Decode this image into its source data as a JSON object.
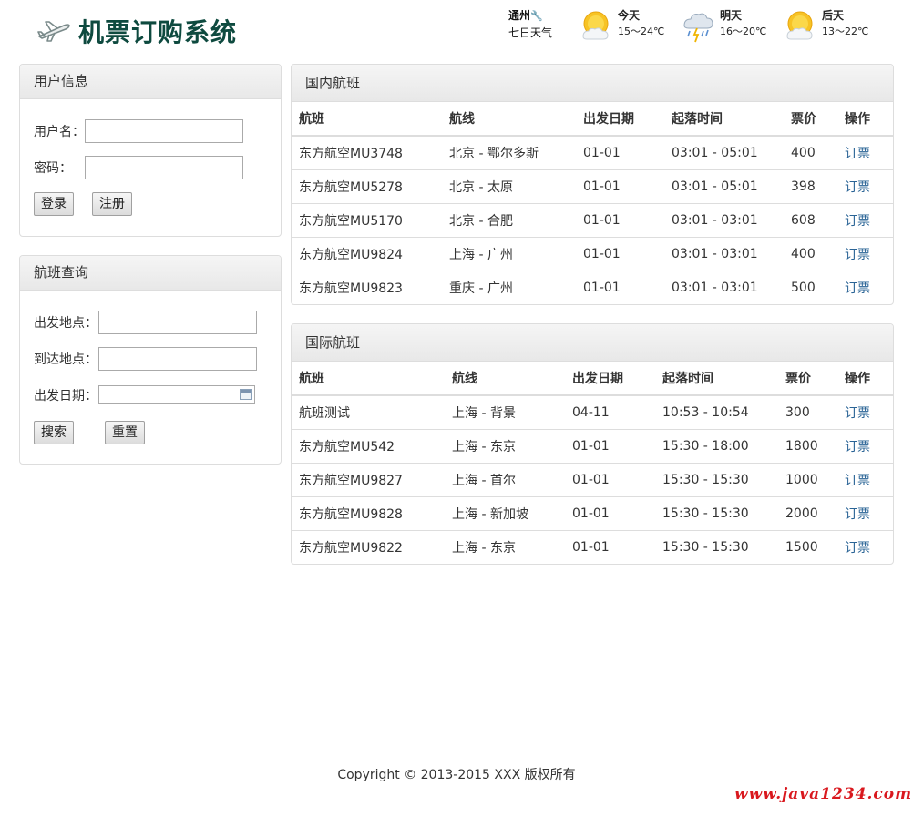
{
  "header": {
    "title": "机票订购系统",
    "weather": {
      "city": "通州",
      "subtitle": "七日天气",
      "days": [
        {
          "name": "今天",
          "range": "15～24℃",
          "icon": "sunny-cloudy-icon"
        },
        {
          "name": "明天",
          "range": "16～20℃",
          "icon": "thunderstorm-icon"
        },
        {
          "name": "后天",
          "range": "13～22℃",
          "icon": "sunny-cloudy-icon"
        }
      ]
    }
  },
  "user_panel": {
    "title": "用户信息",
    "username_label": "用户名：",
    "username_value": "",
    "password_label": "密码：",
    "password_value": "",
    "login_label": "登录",
    "register_label": "注册"
  },
  "search_panel": {
    "title": "航班查询",
    "from_label": "出发地点：",
    "from_value": "",
    "to_label": "到达地点：",
    "to_value": "",
    "date_label": "出发日期：",
    "date_value": "",
    "search_label": "搜索",
    "reset_label": "重置"
  },
  "domestic": {
    "title": "国内航班",
    "columns": [
      "航班",
      "航线",
      "出发日期",
      "起落时间",
      "票价",
      "操作"
    ],
    "rows": [
      {
        "flight": "东方航空MU3748",
        "route": "北京 - 鄂尔多斯",
        "date": "01-01",
        "time": "03:01 - 05:01",
        "price": "400",
        "action": "订票"
      },
      {
        "flight": "东方航空MU5278",
        "route": "北京 - 太原",
        "date": "01-01",
        "time": "03:01 - 05:01",
        "price": "398",
        "action": "订票"
      },
      {
        "flight": "东方航空MU5170",
        "route": "北京 - 合肥",
        "date": "01-01",
        "time": "03:01 - 03:01",
        "price": "608",
        "action": "订票"
      },
      {
        "flight": "东方航空MU9824",
        "route": "上海 - 广州",
        "date": "01-01",
        "time": "03:01 - 03:01",
        "price": "400",
        "action": "订票"
      },
      {
        "flight": "东方航空MU9823",
        "route": "重庆 - 广州",
        "date": "01-01",
        "time": "03:01 - 03:01",
        "price": "500",
        "action": "订票"
      }
    ]
  },
  "international": {
    "title": "国际航班",
    "columns": [
      "航班",
      "航线",
      "出发日期",
      "起落时间",
      "票价",
      "操作"
    ],
    "rows": [
      {
        "flight": "航班测试",
        "route": "上海 - 背景",
        "date": "04-11",
        "time": "10:53 - 10:54",
        "price": "300",
        "action": "订票"
      },
      {
        "flight": "东方航空MU542",
        "route": "上海 - 东京",
        "date": "01-01",
        "time": "15:30 - 18:00",
        "price": "1800",
        "action": "订票"
      },
      {
        "flight": "东方航空MU9827",
        "route": "上海 - 首尔",
        "date": "01-01",
        "time": "15:30 - 15:30",
        "price": "1000",
        "action": "订票"
      },
      {
        "flight": "东方航空MU9828",
        "route": "上海 - 新加坡",
        "date": "01-01",
        "time": "15:30 - 15:30",
        "price": "2000",
        "action": "订票"
      },
      {
        "flight": "东方航空MU9822",
        "route": "上海 - 东京",
        "date": "01-01",
        "time": "15:30 - 15:30",
        "price": "1500",
        "action": "订票"
      }
    ]
  },
  "footer": {
    "copyright": "Copyright © 2013-2015 XXX 版权所有",
    "watermark": "www.java1234.com"
  },
  "colors": {
    "logo": "#0e4a3f",
    "link": "#2a6496",
    "border": "#dddddd",
    "watermark": "#d9181e"
  }
}
